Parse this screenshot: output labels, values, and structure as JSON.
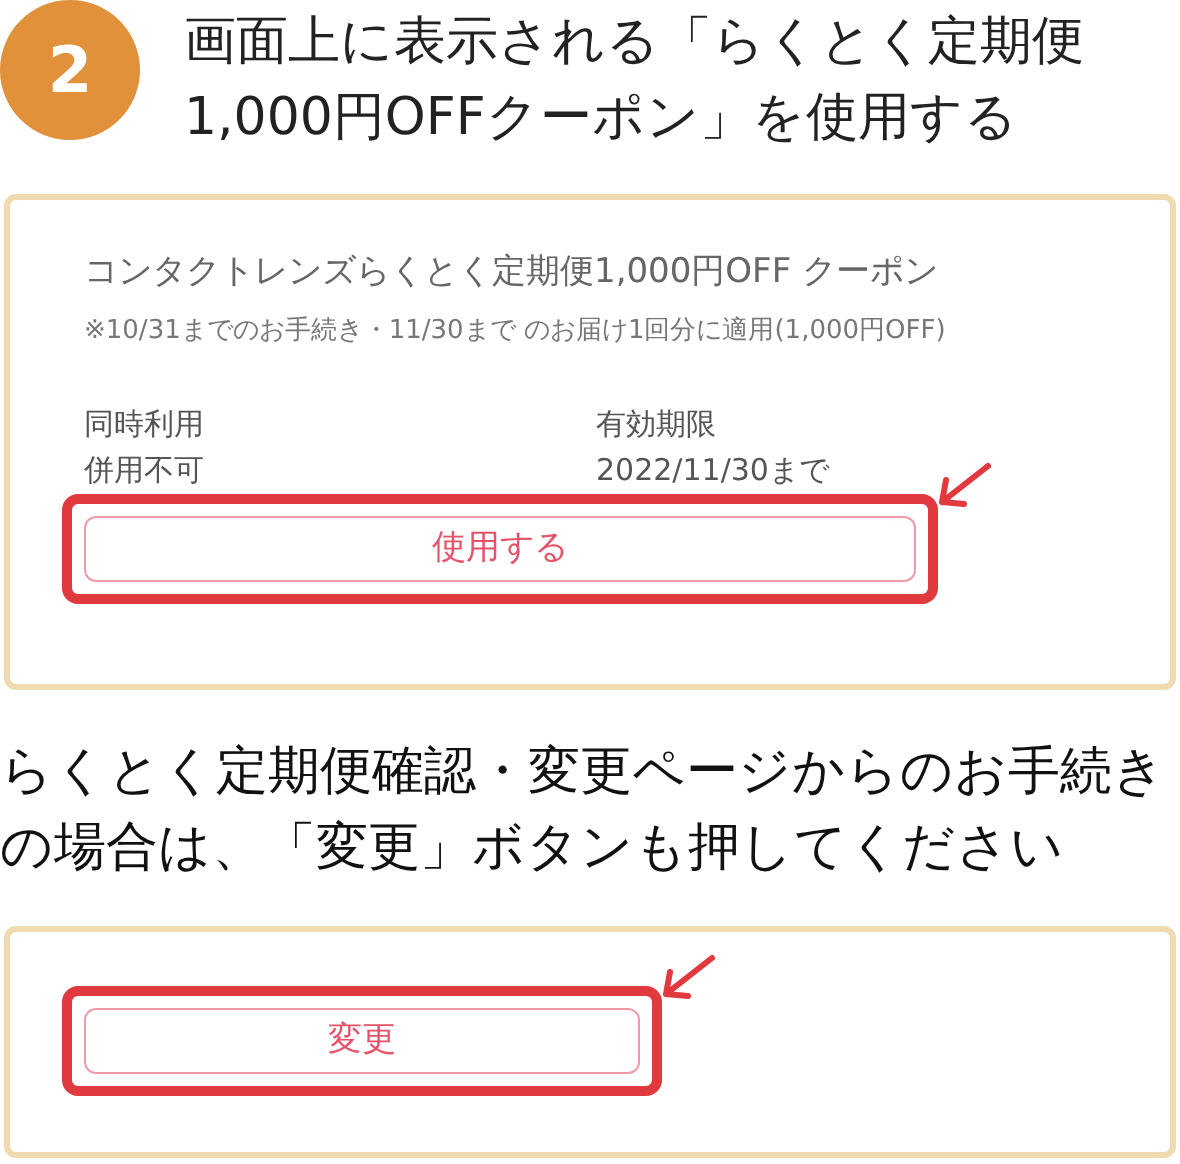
{
  "step": {
    "number": "2",
    "heading_lines": [
      "画面上に表示される「らくとく定期便",
      "1,000円OFFクーポン」を使用する"
    ]
  },
  "coupon_card": {
    "title": "コンタクトレンズらくとく定期便1,000円OFF クーポン",
    "note": "※10/31までのお手続き・11/30まで のお届け1回分に適用(1,000円OFF)",
    "details": [
      {
        "label": "同時利用",
        "value": "併用不可"
      },
      {
        "label": "有効期限",
        "value": "2022/11/30まで"
      }
    ],
    "button": {
      "label": "使用する",
      "highlighted": true
    }
  },
  "instruction": "らくとく定期便確認・変更ページからのお手続きの場合は、「変更」ボタンも押してください",
  "change_card": {
    "button": {
      "label": "変更",
      "highlighted": true
    }
  }
}
